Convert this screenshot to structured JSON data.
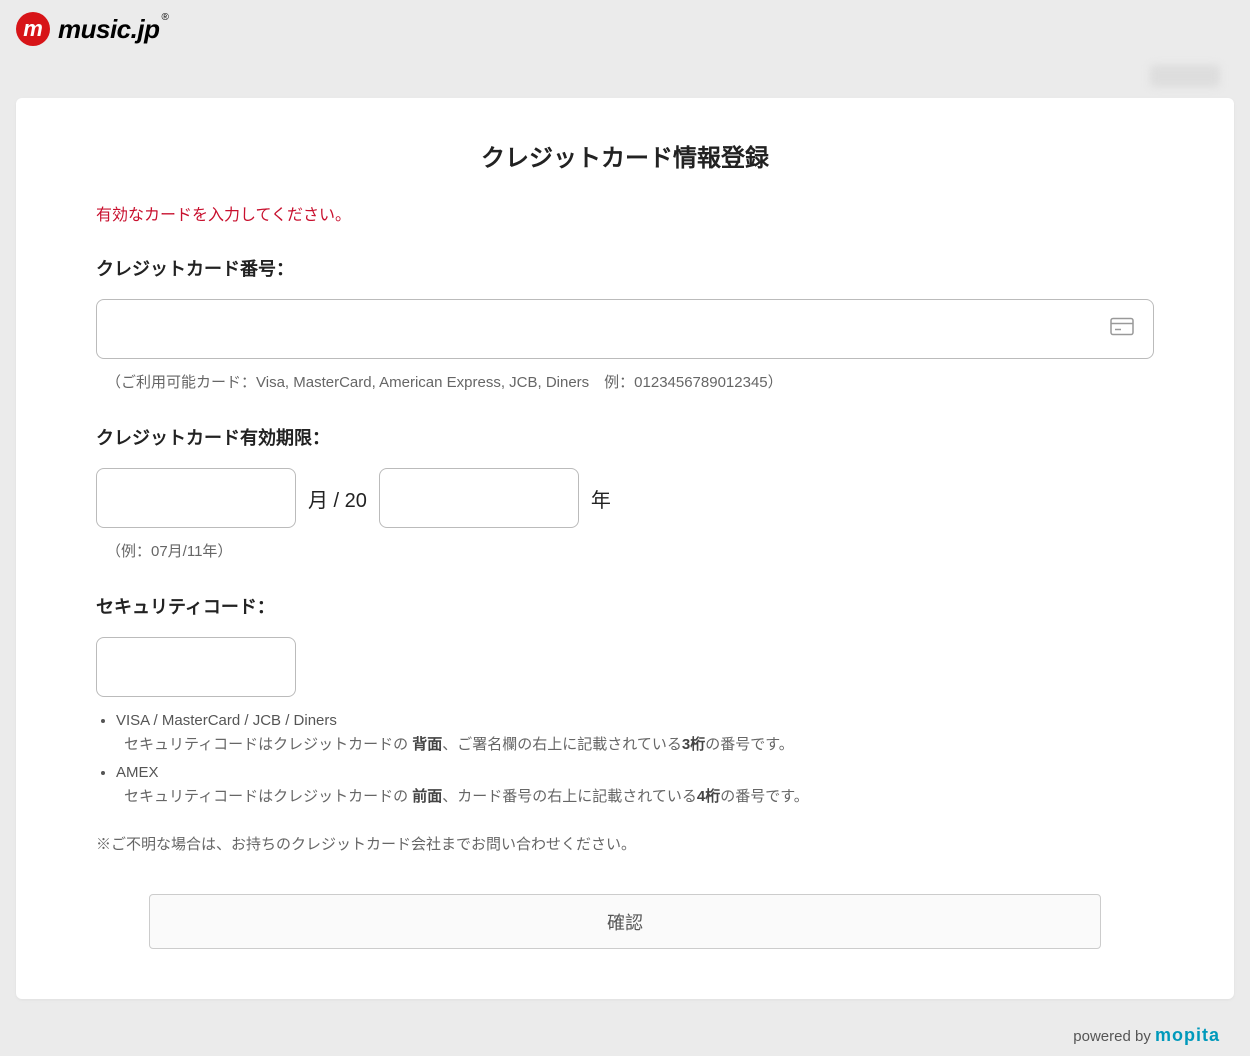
{
  "logo": {
    "mark": "m",
    "text": "music.jp",
    "reg": "®"
  },
  "title": "クレジットカード情報登録",
  "error": "有効なカードを入力してください。",
  "cc": {
    "label": "クレジットカード番号：",
    "hint": "（ご利用可能カード：Visa, MasterCard, American Express, JCB, Diners　例：0123456789012345）"
  },
  "expiry": {
    "label": "クレジットカード有効期限：",
    "month_suffix": "月 / 20",
    "year_suffix": "年",
    "hint": "（例：07月/11年）"
  },
  "security": {
    "label": "セキュリティコード：",
    "item1_name": "VISA / MasterCard / JCB / Diners",
    "item1_desc_pre": "セキュリティコードはクレジットカードの ",
    "item1_bold1": "背面",
    "item1_desc_mid": "、ご署名欄の右上に記載されている",
    "item1_bold2": "3桁",
    "item1_desc_post": "の番号です。",
    "item2_name": "AMEX",
    "item2_desc_pre": "セキュリティコードはクレジットカードの ",
    "item2_bold1": "前面",
    "item2_desc_mid": "、カード番号の右上に記載されている",
    "item2_bold2": "4桁",
    "item2_desc_post": "の番号です。",
    "note": "※ご不明な場合は、お持ちのクレジットカード会社までお問い合わせください。"
  },
  "confirm": "確認",
  "footer": {
    "powered": "powered by ",
    "brand": "mopita"
  }
}
